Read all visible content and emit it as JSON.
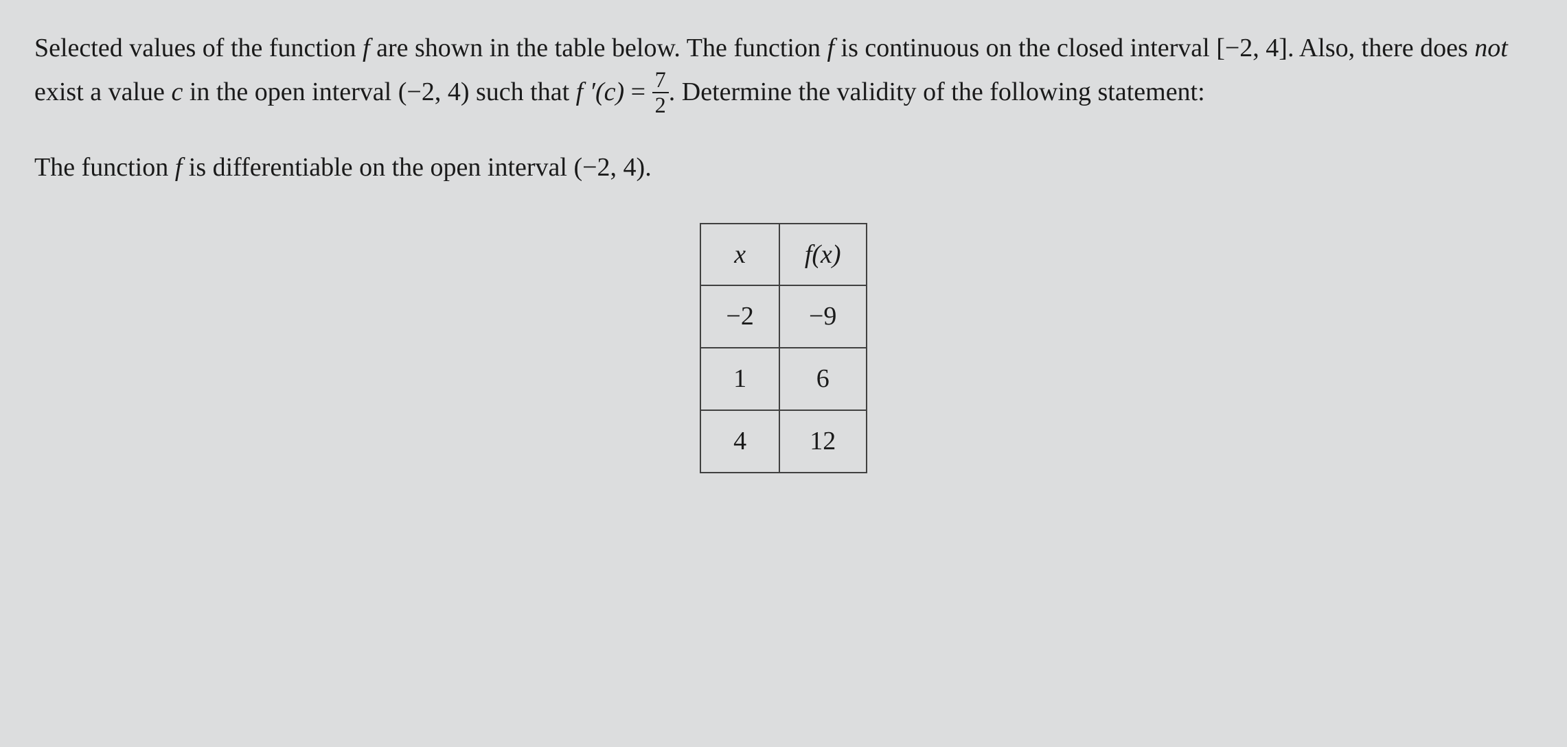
{
  "problem": {
    "part1": "Selected values of the function ",
    "f1": "f",
    "part2": " are shown in the table below. The function ",
    "f2": "f",
    "part3": " is continuous on the closed interval ",
    "interval1_open": "[",
    "interval1_a": "−2",
    "interval1_comma": ", ",
    "interval1_b": "4",
    "interval1_close": "]",
    "part4": ". Also, there does ",
    "not": "not",
    "part5": " exist a value ",
    "c": "c",
    "part6": " in the open interval ",
    "interval2_open": "(",
    "interval2_a": "−2",
    "interval2_comma": ", ",
    "interval2_b": "4",
    "interval2_close": ")",
    "part7": " such that ",
    "fprime": "f ′(c)",
    "equals": " = ",
    "frac_num": "7",
    "frac_den": "2",
    "part8": ". Determine the validity of the following statement:"
  },
  "statement": {
    "part1": "The function ",
    "f": "f",
    "part2": " is differentiable on the open interval ",
    "interval_open": "(",
    "interval_a": "−2",
    "interval_comma": ", ",
    "interval_b": "4",
    "interval_close": ")",
    "part3": "."
  },
  "table": {
    "header_x": "x",
    "header_fx": "f(x)",
    "rows": [
      {
        "x": "−2",
        "fx": "−9"
      },
      {
        "x": "1",
        "fx": "6"
      },
      {
        "x": "4",
        "fx": "12"
      }
    ]
  },
  "chart_data": {
    "type": "table",
    "columns": [
      "x",
      "f(x)"
    ],
    "rows": [
      [
        -2,
        -9
      ],
      [
        1,
        6
      ],
      [
        4,
        12
      ]
    ]
  }
}
